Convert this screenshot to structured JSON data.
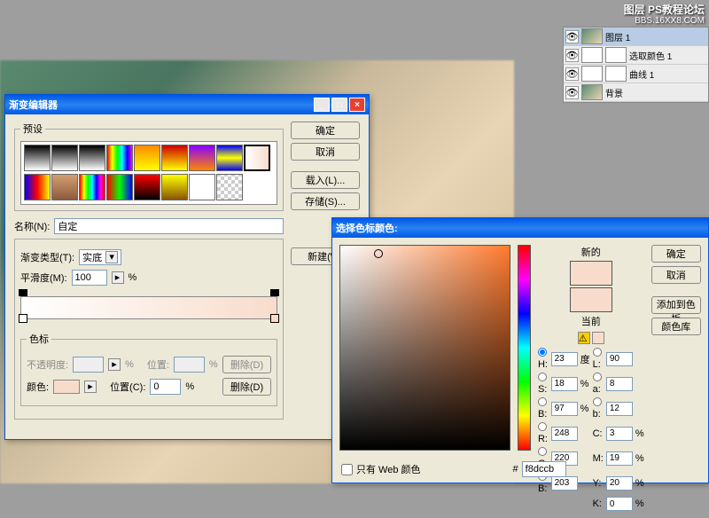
{
  "watermark": {
    "line1": "图层 PS教程论坛",
    "line2": "BBS.16XX8.COM"
  },
  "layers": {
    "items": [
      {
        "name": "图层 1",
        "type": "img"
      },
      {
        "name": "选取颜色 1",
        "type": "adj"
      },
      {
        "name": "曲线 1",
        "type": "adj"
      },
      {
        "name": "背景",
        "type": "img"
      }
    ]
  },
  "gradient_editor": {
    "title": "渐变编辑器",
    "presets_label": "预设",
    "ok": "确定",
    "cancel": "取消",
    "load": "载入(L)...",
    "save": "存储(S)...",
    "name_label": "名称(N):",
    "name_value": "自定",
    "new_btn": "新建(W)",
    "type_label": "渐变类型(T):",
    "type_value": "实底",
    "smooth_label": "平滑度(M):",
    "smooth_value": "100",
    "smooth_unit": "%",
    "stops_label": "色标",
    "opacity_label": "不透明度:",
    "pos_label": "位置:",
    "pos2_label": "位置(C):",
    "pos2_value": "0",
    "color_label": "颜色:",
    "delete_label": "删除(D)",
    "pct": "%"
  },
  "color_picker": {
    "title": "选择色标颜色:",
    "ok": "确定",
    "cancel": "取消",
    "add_swatch": "添加到色板",
    "color_libs": "颜色库",
    "new_label": "新的",
    "current_label": "当前",
    "web_only": "只有 Web 颜色",
    "hex": "f8dccb",
    "H": "23",
    "S": "18",
    "B": "97",
    "R": "248",
    "G": "220",
    "Bv": "203",
    "L": "90",
    "a": "8",
    "b": "12",
    "C": "3",
    "M": "19",
    "Y": "20",
    "K": "0",
    "deg": "度",
    "pct": "%",
    "labels": {
      "H": "H:",
      "S": "S:",
      "B": "B:",
      "R": "R:",
      "G": "G:",
      "Bv": "B:",
      "L": "L:",
      "a": "a:",
      "b": "b:",
      "C": "C:",
      "M": "M:",
      "Y": "Y:",
      "K": "K:"
    }
  },
  "chart_data": {
    "type": "gradient",
    "stops": [
      {
        "position": 0,
        "color": "#ffffff"
      },
      {
        "position": 100,
        "color": "#f8dccb"
      }
    ]
  }
}
